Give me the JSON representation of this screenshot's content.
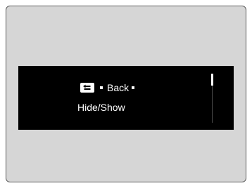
{
  "menu": {
    "back_label": "Back",
    "hide_show_label": "Hide/Show"
  },
  "icons": {
    "back": "back-arrow-icon"
  },
  "colors": {
    "outer_background": "#d6d6d6",
    "screen_background": "#000000",
    "text": "#ffffff"
  }
}
